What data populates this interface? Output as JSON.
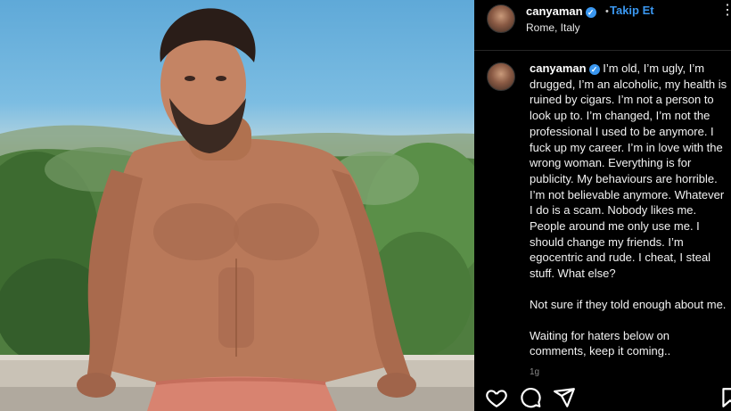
{
  "post": {
    "username": "canyaman",
    "verified_icon": "verified-badge-icon",
    "follow_label": "Takip Et",
    "location": "Rome, Italy",
    "dot": "•",
    "more_icon": "more-vertical-icon"
  },
  "caption": {
    "username": "canyaman",
    "paragraph1": "I’m old, I’m ugly, I’m drugged, I’m an alcoholic, my health is ruined by cigars. I’m not a person to look up to. I’m changed, I’m not the professional I used to be anymore. I fuck up my career. I’m in love with the wrong woman. Everything is for publicity. My behaviours are horrible. I’m not believable anymore. Whatever I do is a scam. Nobody likes me. People around me only use me. I should change my friends. I’m egocentric and rude. I cheat, I steal stuff. What else?",
    "paragraph2": "Not sure if they told enough about me.",
    "paragraph3": "Waiting for haters below on comments, keep it coming..",
    "time": "1g"
  },
  "actions": {
    "like_icon": "heart-icon",
    "comment_icon": "comment-icon",
    "share_icon": "share-icon",
    "save_icon": "bookmark-icon"
  },
  "colors": {
    "accent": "#3a97f0",
    "panel_bg": "#000000",
    "text": "#f5f5f5"
  }
}
